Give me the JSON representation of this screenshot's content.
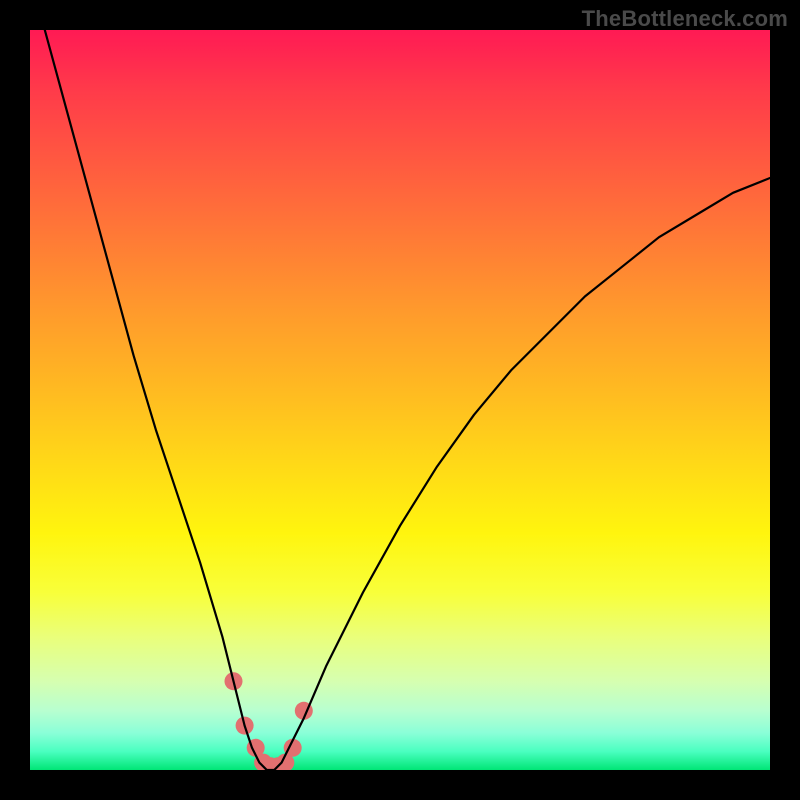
{
  "watermark": "TheBottleneck.com",
  "chart_data": {
    "type": "line",
    "title": "",
    "xlabel": "",
    "ylabel": "",
    "xlim": [
      0,
      100
    ],
    "ylim": [
      0,
      100
    ],
    "series": [
      {
        "name": "bottleneck-curve",
        "x": [
          2,
          5,
          8,
          11,
          14,
          17,
          20,
          23,
          26,
          28,
          29,
          30,
          31,
          32,
          33,
          34,
          35,
          37,
          40,
          45,
          50,
          55,
          60,
          65,
          70,
          75,
          80,
          85,
          90,
          95,
          100
        ],
        "values": [
          100,
          89,
          78,
          67,
          56,
          46,
          37,
          28,
          18,
          10,
          6,
          3,
          1,
          0,
          0,
          1,
          3,
          7,
          14,
          24,
          33,
          41,
          48,
          54,
          59,
          64,
          68,
          72,
          75,
          78,
          80
        ]
      }
    ],
    "markers": {
      "name": "highlight-dots",
      "x": [
        27.5,
        29.0,
        30.5,
        31.5,
        32.5,
        33.5,
        34.5,
        35.5,
        37.0
      ],
      "values": [
        12,
        6,
        3,
        1,
        0.5,
        0.5,
        1,
        3,
        8
      ],
      "color": "#e27070",
      "radius": 9
    },
    "gradient_stops": [
      {
        "pos": 0.0,
        "color": "#ff1a54"
      },
      {
        "pos": 0.18,
        "color": "#ff5a40"
      },
      {
        "pos": 0.38,
        "color": "#ff9a2c"
      },
      {
        "pos": 0.58,
        "color": "#ffd718"
      },
      {
        "pos": 0.76,
        "color": "#f8ff3a"
      },
      {
        "pos": 0.92,
        "color": "#b8ffd0"
      },
      {
        "pos": 1.0,
        "color": "#00e676"
      }
    ]
  }
}
